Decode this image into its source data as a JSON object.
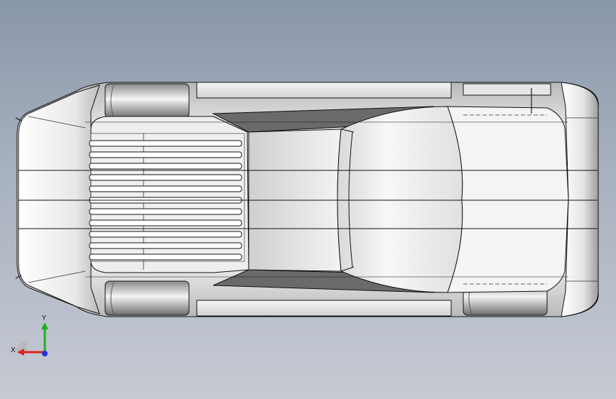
{
  "view": {
    "background_top": "#8a97aa",
    "background_bottom": "#c6cad3",
    "body_color": "#f2f2f2",
    "edge_color": "#111111"
  },
  "triad": {
    "x_label": "X",
    "y_label": "Y",
    "x_color": "#e02020",
    "y_color": "#20b020",
    "z_color": "#2030e0"
  }
}
